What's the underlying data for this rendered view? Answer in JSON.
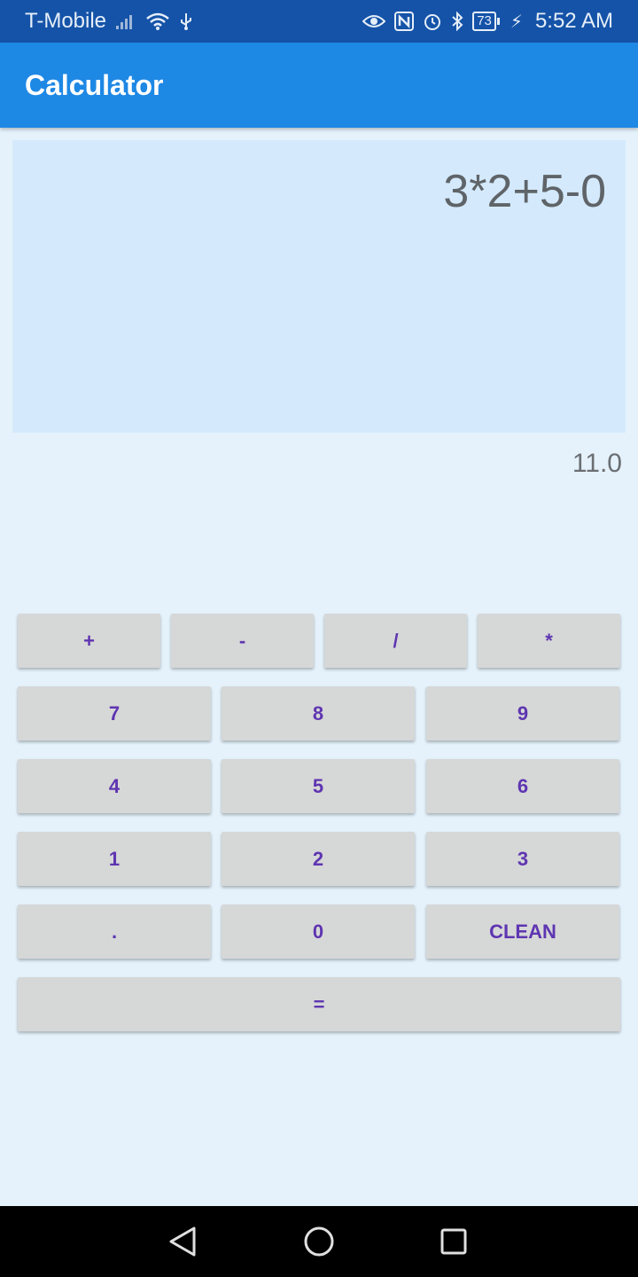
{
  "status_bar": {
    "carrier": "T-Mobile",
    "battery": "73",
    "time": "5:52 AM",
    "icons": [
      "signal-icon",
      "wifi-icon",
      "usb-icon",
      "eye-icon",
      "nfc-icon",
      "alarm-icon",
      "bluetooth-icon",
      "battery-icon",
      "charging-icon"
    ]
  },
  "app_bar": {
    "title": "Calculator"
  },
  "display": {
    "expression": "3*2+5-0",
    "result": "11.0"
  },
  "keypad": {
    "operators": [
      "+",
      "-",
      "/",
      "*"
    ],
    "rows": [
      [
        "7",
        "8",
        "9"
      ],
      [
        "4",
        "5",
        "6"
      ],
      [
        "1",
        "2",
        "3"
      ],
      [
        ".",
        "0",
        "CLEAN"
      ]
    ],
    "equals": "="
  },
  "colors": {
    "status_bar": "#1453A8",
    "app_bar": "#1E88E5",
    "background": "#E5F2FB",
    "display_panel": "#D4EAFC",
    "button": "#D6D7D7",
    "button_text": "#5E35B1"
  }
}
